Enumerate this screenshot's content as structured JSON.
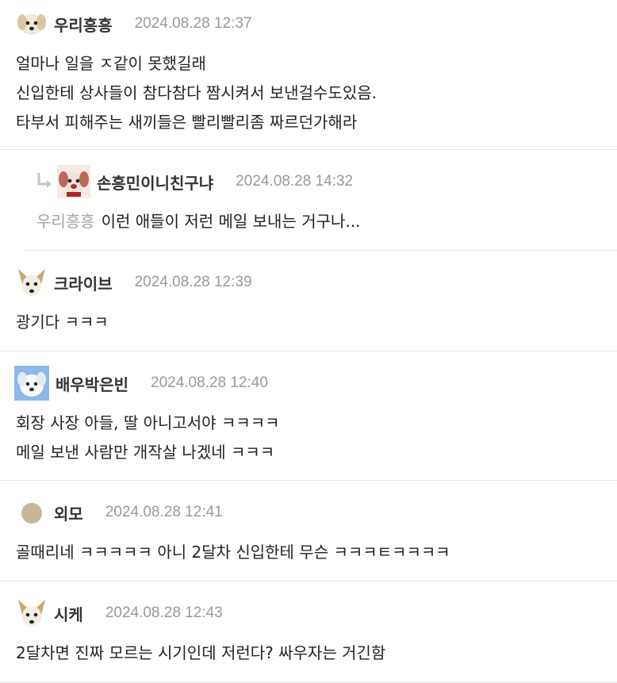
{
  "comments": [
    {
      "nickname": "우리흥흥",
      "date": "2024.08.28 12:37",
      "lines": [
        "얼마나 일을 ㅈ같이 못했길래",
        "신입한테 상사들이 참다참다 짬시켜서 보낸걸수도있음.",
        "타부서 피해주는 새끼들은 빨리빨리좀 짜르던가해라"
      ]
    },
    {
      "nickname": "손흥민이니친구냐",
      "date": "2024.08.28 14:32",
      "reply_to": "우리흥흥",
      "text": "이런 애들이 저런 메일 보내는 거구나..."
    },
    {
      "nickname": "크라이브",
      "date": "2024.08.28 12:39",
      "lines": [
        "광기다 ㅋㅋㅋ"
      ]
    },
    {
      "nickname": "배우박은빈",
      "date": "2024.08.28 12:40",
      "lines": [
        "회장 사장 아들, 딸 아니고서야 ㅋㅋㅋㅋ",
        "메일 보낸 사람만 개작살 나겠네 ㅋㅋㅋ"
      ]
    },
    {
      "nickname": "외모",
      "date": "2024.08.28 12:41",
      "lines": [
        "골때리네 ㅋㅋㅋㅋㅋ 아니 2달차 신입한테 무슨 ㅋㅋㅋㅌㅋㅋㅋㅋ"
      ]
    },
    {
      "nickname": "시케",
      "date": "2024.08.28 12:43",
      "lines": [
        "2달차면 진짜 모르는 시기인데 저런다? 싸우자는 거긴함"
      ]
    }
  ],
  "icons": {
    "reply_arrow": "reply-arrow-icon",
    "avatar_dog_white": "white-puppy-avatar-icon",
    "avatar_dog_red": "puppy-with-red-avatar-icon",
    "avatar_chihuahua": "chihuahua-avatar-icon",
    "avatar_dog_blue": "blue-sky-puppy-avatar-icon",
    "avatar_circle": "beige-circle-avatar-icon"
  },
  "colors": {
    "nickname": "#333333",
    "date": "#999999",
    "divider": "#e6e6e6",
    "reply_to": "#a5a5a5",
    "reply_arrow": "#c5c5c5"
  }
}
